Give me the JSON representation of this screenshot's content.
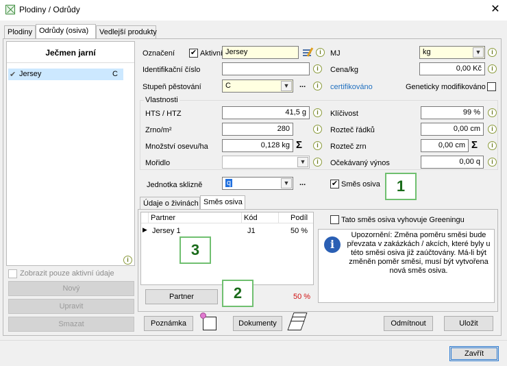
{
  "window": {
    "title": "Plodiny / Odrůdy",
    "close": "✕"
  },
  "tabs": [
    "Plodiny",
    "Odrůdy (osiva)",
    "Vedlejší produkty"
  ],
  "left": {
    "header": "Ječmen jarní",
    "items": [
      {
        "check": "✔",
        "name": "Jersey",
        "code": "C"
      }
    ],
    "only_active": "Zobrazit pouze aktivní údaje",
    "btn_new": "Nový",
    "btn_edit": "Upravit",
    "btn_delete": "Smazat"
  },
  "form": {
    "oznaceni_label": "Označení",
    "aktivni_label": "Aktivní",
    "oznaceni_value": "Jersey",
    "mj_label": "MJ",
    "mj_value": "kg",
    "ident_label": "Identifikační číslo",
    "ident_value": "",
    "cena_label": "Cena/kg",
    "cena_value": "0,00 Kč",
    "stupen_label": "Stupeň pěstování",
    "stupen_value": "C",
    "dots": "...",
    "certifikovano": "certifikováno",
    "gmo_label": "Geneticky modifikováno",
    "vlastnosti": "Vlastnosti",
    "hts_label": "HTS / HTZ",
    "hts_value": "41,5 g",
    "klicivost_label": "Klíčivost",
    "klicivost_value": "99 %",
    "zrno_label": "Zrno/m²",
    "zrno_value": "280",
    "roztec_radku_label": "Rozteč řádků",
    "roztec_radku_value": "0,00 cm",
    "mnozstvi_label": "Množství osevu/ha",
    "mnozstvi_value": "0,128 kg",
    "roztec_zrn_label": "Rozteč zrn",
    "roztec_zrn_value": "0,00 cm",
    "moridlo_label": "Mořidlo",
    "moridlo_value": "",
    "ocekavany_label": "Očekávaný výnos",
    "ocekavany_value": "0,00 q",
    "jednotka_label": "Jednotka sklizně",
    "jednotka_value": "q",
    "smes_label": "Směs osiva"
  },
  "subtabs": [
    "Údaje o živinách",
    "Směs osiva"
  ],
  "grid": {
    "headers": [
      "Partner",
      "Kód",
      "Podíl"
    ],
    "rows": [
      {
        "marker": "▶",
        "partner": "Jersey 1",
        "kod": "J1",
        "podil": "50 %"
      }
    ]
  },
  "greening_label": "Tato směs osiva vyhovuje Greeningu",
  "warning": "Upozornění: Změna poměru směsi bude převzata v zakázkách / akcích, které byly u této směsi osiva již zaúčtovány. Má-li být změněn poměr směsi, musí být vytvořena nová směs osiva.",
  "partner_btn": "Partner",
  "total_pct": "50 %",
  "bottom": {
    "poznamka": "Poznámka",
    "dokumenty": "Dokumenty",
    "odmitnout": "Odmítnout",
    "ulozit": "Uložit",
    "zavrit": "Zavřít"
  },
  "callouts": [
    "1",
    "2",
    "3"
  ],
  "icons": {
    "info": "i",
    "sigma": "Σ",
    "check": "✔",
    "combo": "▼"
  },
  "colors": {
    "selection": "#cce8ff",
    "yellow_field": "#ffffe1",
    "link": "#1f6fbf",
    "red_text": "#d01010",
    "callout_green": "#1a6b1a"
  }
}
